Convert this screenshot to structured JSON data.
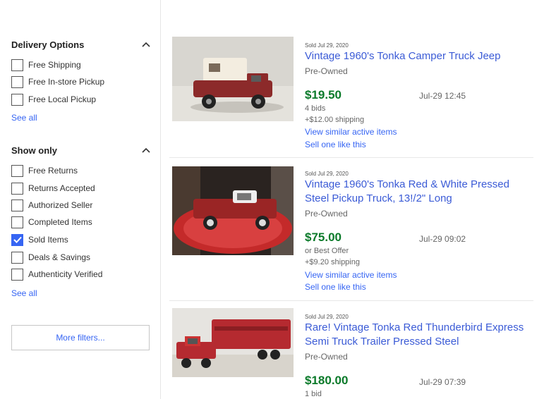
{
  "filters": {
    "delivery": {
      "title": "Delivery Options",
      "options": [
        {
          "label": "Free Shipping",
          "checked": false
        },
        {
          "label": "Free In-store Pickup",
          "checked": false
        },
        {
          "label": "Free Local Pickup",
          "checked": false
        }
      ],
      "see_all": "See all"
    },
    "show_only": {
      "title": "Show only",
      "options": [
        {
          "label": "Free Returns",
          "checked": false
        },
        {
          "label": "Returns Accepted",
          "checked": false
        },
        {
          "label": "Authorized Seller",
          "checked": false
        },
        {
          "label": "Completed Items",
          "checked": false
        },
        {
          "label": "Sold Items",
          "checked": true
        },
        {
          "label": "Deals & Savings",
          "checked": false
        },
        {
          "label": "Authenticity Verified",
          "checked": false
        }
      ],
      "see_all": "See all"
    },
    "more_filters": "More filters..."
  },
  "listings": [
    {
      "sold_date": "Sold Jul 29, 2020",
      "title": "Vintage 1960's Tonka Camper Truck Jeep",
      "condition": "Pre-Owned",
      "price": "$19.50",
      "time": "Jul-29 12:45",
      "details": [
        "4 bids",
        "+$12.00 shipping"
      ],
      "links": [
        "View similar active items",
        "Sell one like this"
      ]
    },
    {
      "sold_date": "Sold Jul 29, 2020",
      "title": "Vintage 1960's Tonka Red & White Pressed Steel Pickup Truck, 13!/2\" Long",
      "condition": "Pre-Owned",
      "price": "$75.00",
      "time": "Jul-29 09:02",
      "details": [
        "or Best Offer",
        "+$9.20 shipping"
      ],
      "links": [
        "View similar active items",
        "Sell one like this"
      ]
    },
    {
      "sold_date": "Sold Jul 29, 2020",
      "title": "Rare! Vintage Tonka Red Thunderbird Express Semi Truck Trailer Pressed Steel",
      "condition": "Pre-Owned",
      "price": "$180.00",
      "time": "Jul-29 07:39",
      "details": [
        "1 bid"
      ],
      "links": []
    }
  ],
  "colors": {
    "link": "#3665f3",
    "title_link": "#3b5bd6",
    "price": "#0b7a2a",
    "checkbox_checked": "#3665f3"
  }
}
